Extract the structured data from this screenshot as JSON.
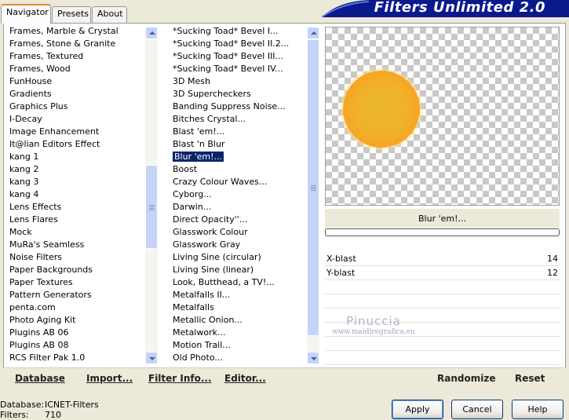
{
  "tabs": [
    {
      "label": "Navigator",
      "active": true
    },
    {
      "label": "Presets",
      "active": false
    },
    {
      "label": "About",
      "active": false
    }
  ],
  "title": "Filters Unlimited 2.0",
  "categories": [
    "Frames, Marble & Crystal",
    "Frames, Stone & Granite",
    "Frames, Textured",
    "Frames, Wood",
    "FunHouse",
    "Gradients",
    "Graphics Plus",
    "I-Decay",
    "Image Enhancement",
    "It@lian Editors Effect",
    "kang 1",
    "kang 2",
    "kang 3",
    "kang 4",
    "Lens Effects",
    "Lens Flares",
    "Mock",
    "MuRa's Seamless",
    "Noise Filters",
    "Paper Backgrounds",
    "Paper Textures",
    "Pattern Generators",
    "penta.com",
    "Photo Aging Kit",
    "Plugins AB 06",
    "Plugins AB 08",
    "RCS Filter Pak 1.0"
  ],
  "filters": [
    "*Sucking Toad*  Bevel I...",
    "*Sucking Toad*  Bevel II.2...",
    "*Sucking Toad*  Bevel III...",
    "*Sucking Toad*  Bevel IV...",
    "3D Mesh",
    "3D Supercheckers",
    "Banding Suppress Noise...",
    "Bitches Crystal...",
    "Blast 'em!...",
    "Blast 'n Blur",
    "Blur 'em!...",
    "Boost",
    "Crazy Colour Waves...",
    "Cyborg...",
    "Darwin...",
    "Direct Opacity''...",
    "Glasswork Colour",
    "Glasswork Gray",
    "Living Sine (circular)",
    "Living Sine (linear)",
    "Look, Butthead, a TV!...",
    "Metalfalls II...",
    "Metalfalls",
    "Metallic Onion...",
    "Metalwork...",
    "Motion Trail...",
    "Old Photo..."
  ],
  "selected_filter_index": 10,
  "scrollbar": {
    "categories_thumb_fraction": 0.27,
    "categories_thumb_position": 0.55,
    "filters_thumb_fraction": 0.95,
    "filters_thumb_position": 0.0
  },
  "preview": {
    "filter_name": "Blur 'em!...",
    "progress": 0.0
  },
  "params": [
    {
      "label": "X-blast",
      "value": "14"
    },
    {
      "label": "Y-blast",
      "value": "12"
    }
  ],
  "watermark": {
    "name": "Pinuccia",
    "url": "www.maidiregrafica.eu"
  },
  "toolbar": {
    "database": "Database",
    "import": "Import...",
    "filter_info": "Filter Info...",
    "editor": "Editor...",
    "randomize": "Randomize",
    "reset": "Reset"
  },
  "status": {
    "database_label": "Database:",
    "database_value": "ICNET-Filters",
    "filters_label": "Filters:",
    "filters_value": "710"
  },
  "dialog_buttons": {
    "apply": "Apply",
    "cancel": "Cancel",
    "help": "Help"
  },
  "colors": {
    "banner": "#0a1a8c",
    "selection": "#0a246a",
    "tab_highlight": "#e68b2c"
  }
}
